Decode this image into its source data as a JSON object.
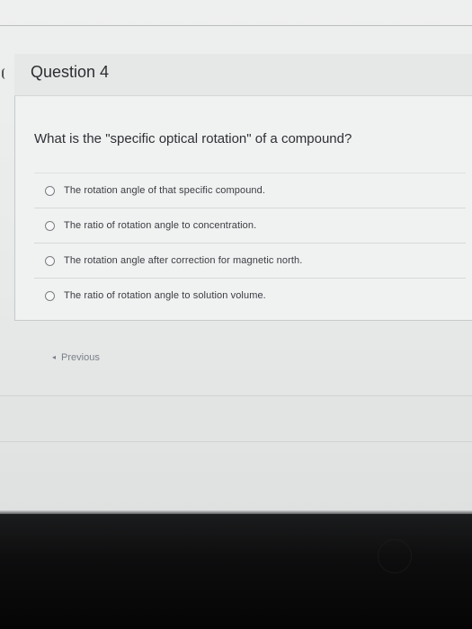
{
  "question": {
    "title": "Question 4",
    "text": "What is the \"specific optical rotation\" of a compound?",
    "options": [
      {
        "label": "The rotation angle of that specific compound."
      },
      {
        "label": "The ratio of rotation angle to concentration."
      },
      {
        "label": "The rotation angle after correction for magnetic north."
      },
      {
        "label": "The ratio of rotation angle to solution volume."
      }
    ]
  },
  "navigation": {
    "previous_label": "Previous"
  }
}
